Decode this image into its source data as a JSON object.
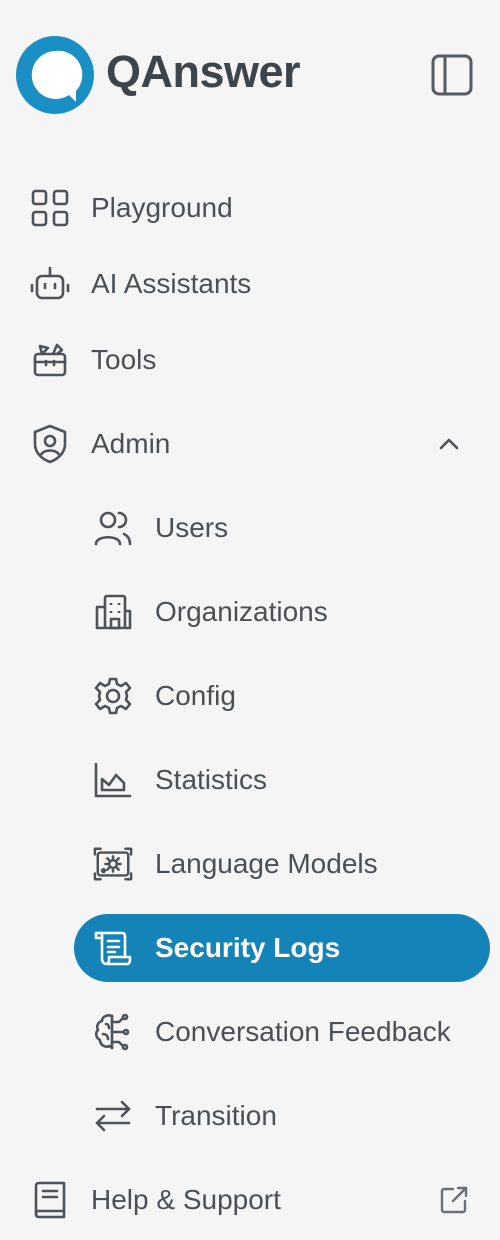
{
  "brand": {
    "name": "QAnswer",
    "color": "#1a8fc4"
  },
  "header": {
    "collapse_icon": "sidebar-toggle-icon"
  },
  "nav": {
    "playground": {
      "label": "Playground",
      "icon": "grid-icon"
    },
    "ai_assistants": {
      "label": "AI Assistants",
      "icon": "robot-icon"
    },
    "tools": {
      "label": "Tools",
      "icon": "toolbox-icon"
    },
    "admin": {
      "label": "Admin",
      "icon": "shield-user-icon",
      "expanded": true,
      "children": {
        "users": {
          "label": "Users",
          "icon": "users-icon"
        },
        "organizations": {
          "label": "Organizations",
          "icon": "building-icon"
        },
        "config": {
          "label": "Config",
          "icon": "gear-icon"
        },
        "statistics": {
          "label": "Statistics",
          "icon": "chart-icon"
        },
        "language_models": {
          "label": "Language Models",
          "icon": "model-icon"
        },
        "security_logs": {
          "label": "Security Logs",
          "icon": "scroll-icon",
          "active": true
        },
        "conversation_feedback": {
          "label": "Conversation Feedback",
          "icon": "brain-icon"
        },
        "transition": {
          "label": "Transition",
          "icon": "arrows-exchange-icon"
        }
      }
    },
    "help": {
      "label": "Help & Support",
      "icon": "book-icon",
      "external": true
    }
  },
  "colors": {
    "active_bg": "#1484b8",
    "text": "#4a5056",
    "icon": "#4d5358",
    "background": "#f5f5f5"
  }
}
